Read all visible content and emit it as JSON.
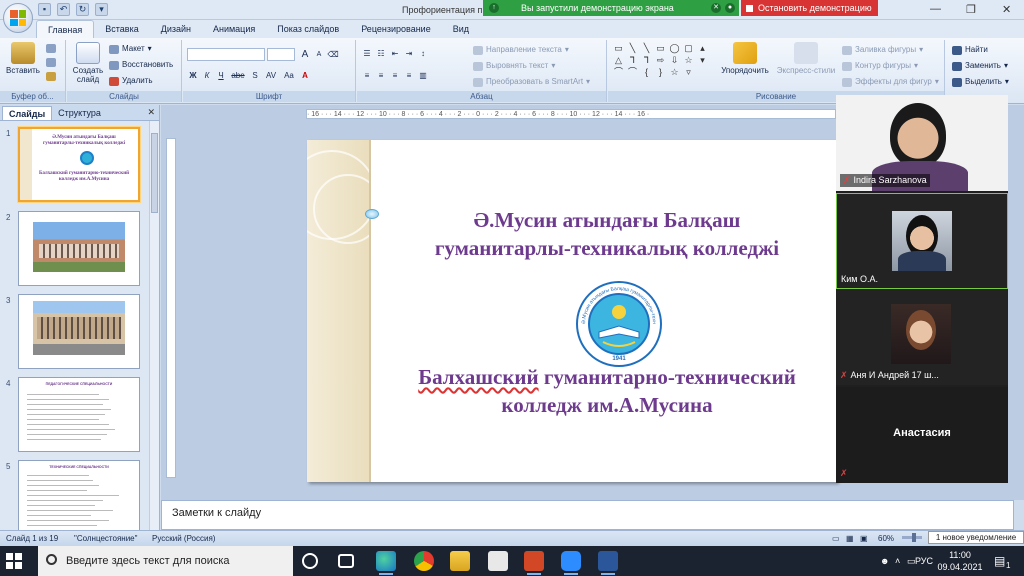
{
  "titlebar": {
    "doc_title": "Профориентация п",
    "demo_banner": "Вы запустили демонстрацию экрана",
    "stop_demo": "Остановить демонстрацию"
  },
  "tabs": [
    "Главная",
    "Вставка",
    "Дизайн",
    "Анимация",
    "Показ слайдов",
    "Рецензирование",
    "Вид"
  ],
  "ribbon": {
    "clipboard": {
      "paste": "Вставить",
      "label": "Буфер об..."
    },
    "slides": {
      "create": "Создать слайд",
      "layout": "Макет",
      "reset": "Восстановить",
      "delete": "Удалить",
      "label": "Слайды"
    },
    "font": {
      "label": "Шрифт",
      "bold": "Ж",
      "italic": "К",
      "underline": "Ч",
      "strike": "abe",
      "shadow": "S",
      "spacing": "AV",
      "case": "Aa",
      "grow": "A",
      "shrink": "A"
    },
    "paragraph": {
      "text_direction": "Направление текста",
      "align_text": "Выровнять текст",
      "smartart": "Преобразовать в SmartArt",
      "label": "Абзац"
    },
    "drawing": {
      "arrange": "Упорядочить",
      "styles": "Экспресс-стили",
      "fill": "Заливка фигуры",
      "outline": "Контур фигуры",
      "effects": "Эффекты для фигур",
      "label": "Рисование"
    },
    "editing": {
      "find": "Найти",
      "replace": "Заменить",
      "select": "Выделить"
    }
  },
  "panel": {
    "tab_slides": "Слайды",
    "tab_outline": "Структура",
    "thumbs": [
      {
        "num": "1",
        "kind": "title",
        "t1": "Ә.Мусин атындағы Балқаш",
        "t2": "гуманитарлы-техникалық колледжі",
        "t3": "Балхашский гуманитарно-технический",
        "t4": "колледж им.А.Мусина"
      },
      {
        "num": "2",
        "kind": "photo"
      },
      {
        "num": "3",
        "kind": "photo"
      },
      {
        "num": "4",
        "kind": "text",
        "heading": "ПЕДАГОГИЧЕСКИЕ СПЕЦИАЛЬНОСТИ"
      },
      {
        "num": "5",
        "kind": "text",
        "heading": "ТЕХНИЧЕСКИЕ СПЕЦИАЛЬНОСТИ"
      }
    ]
  },
  "ruler": {
    "ticks": "· 16 · · · 14 · · · 12 · · · 10 · · · 8 · · · 6 · · · 4 · · · 2 · · · 0 · · · 2 · · · 4 · · · 6 · · · 8 · · · 10 · · · 12 · · · 14 · · · 16 ·"
  },
  "slide": {
    "title_line1": "Ә.Мусин атындағы Балқаш",
    "title_line2": "гуманитарлы-техникалық колледжі",
    "sub_word1": "Балхашский",
    "sub_rest1": " гуманитарно-технический",
    "sub_line2": "колледж им.А.Мусина",
    "logo_text": "Ә.Мусин атындағы Балқаш гуманитарлы-техникалық колледжі",
    "logo_year": "1941"
  },
  "notes_placeholder": "Заметки к слайду",
  "status": {
    "slide_of": "Слайд 1 из 19",
    "theme": "\"Солнцестояние\"",
    "lang": "Русский (Россия)",
    "zoom": "60%",
    "zoom_fraction": 0.6,
    "notification": "1 новое уведомление"
  },
  "zoom": {
    "participants": [
      {
        "name": "Indira Sarzhanova",
        "muted": true,
        "video": true
      },
      {
        "name": "Ким О.А.",
        "muted": false,
        "video": true,
        "active": true
      },
      {
        "name": "Аня И Андрей 17 ш...",
        "muted": true,
        "video": true
      },
      {
        "name": "Анастасия",
        "muted": true,
        "video": false
      }
    ]
  },
  "taskbar": {
    "search_placeholder": "Введите здесь текст для поиска",
    "lang": "РУС",
    "time": "11:00",
    "date": "09.04.2021",
    "notif_count": "1"
  }
}
